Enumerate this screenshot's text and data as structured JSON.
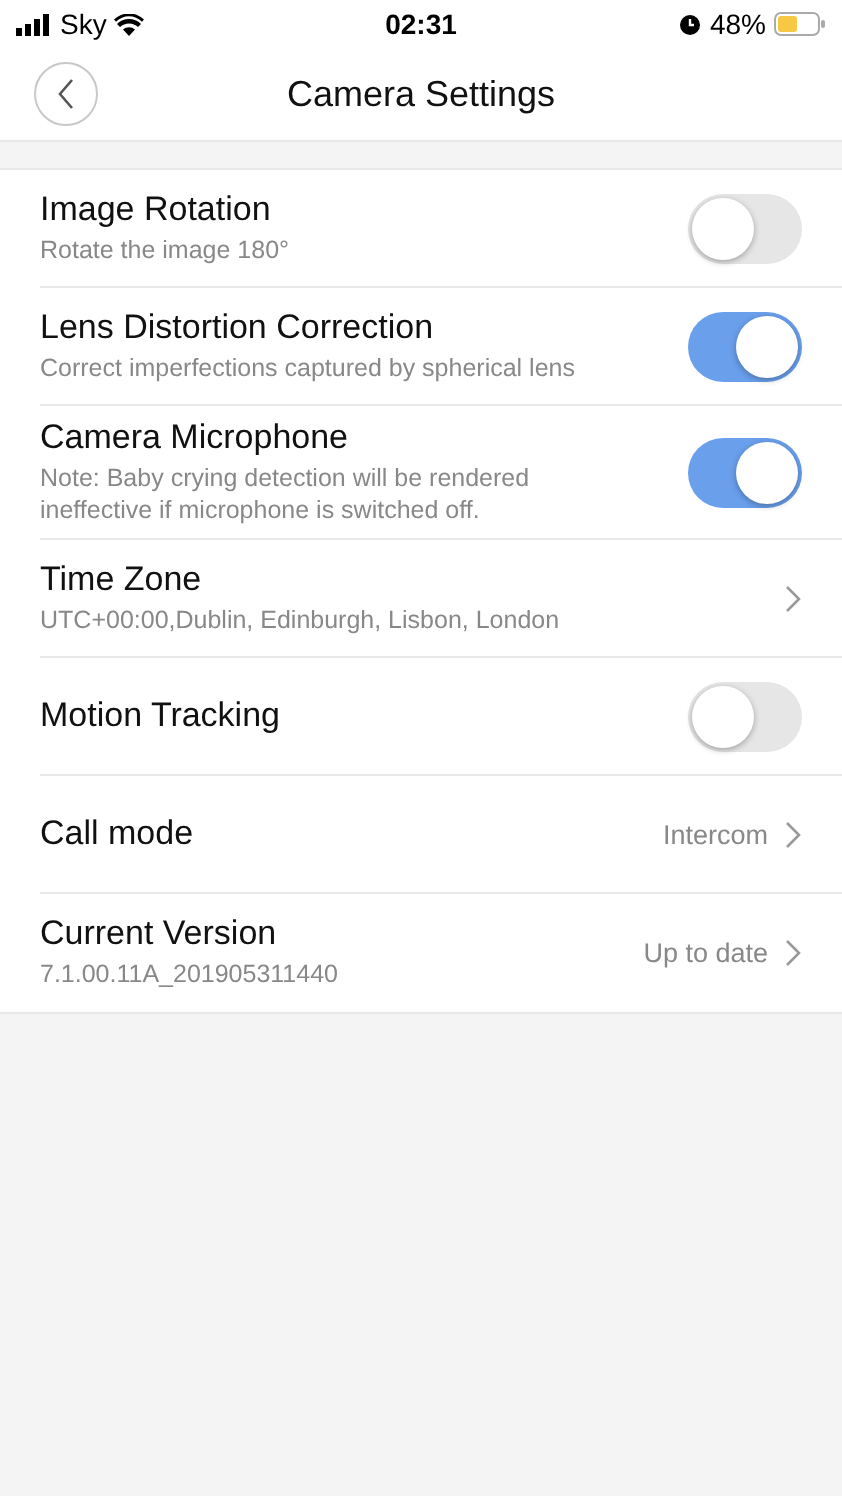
{
  "status_bar": {
    "carrier": "Sky",
    "time": "02:31",
    "battery": "48%"
  },
  "header": {
    "title": "Camera Settings"
  },
  "settings": [
    {
      "kind": "toggle",
      "label": "Image Rotation",
      "subtitle": "Rotate the image 180°",
      "on": false
    },
    {
      "kind": "toggle",
      "label": "Lens Distortion Correction",
      "subtitle": "Correct imperfections captured by spherical lens",
      "on": true
    },
    {
      "kind": "toggle",
      "label": "Camera Microphone",
      "subtitle": "Note: Baby crying detection will be rendered ineffective if microphone is switched off.",
      "on": true
    },
    {
      "kind": "link",
      "label": "Time Zone",
      "subtitle": "UTC+00:00,Dublin, Edinburgh, Lisbon, London"
    },
    {
      "kind": "toggle",
      "label": "Motion Tracking",
      "on": false
    },
    {
      "kind": "link",
      "label": "Call mode",
      "value": "Intercom"
    },
    {
      "kind": "link",
      "label": "Current Version",
      "subtitle": "7.1.00.11A_201905311440",
      "value": "Up to date"
    }
  ]
}
